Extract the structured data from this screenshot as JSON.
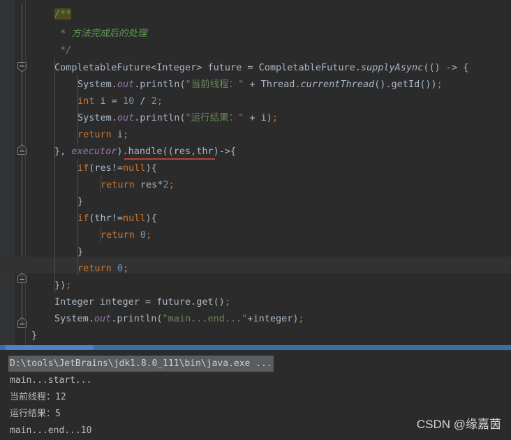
{
  "editor": {
    "theme": {
      "background": "#2b2b2b",
      "gutter_background": "#313335",
      "current_line": "#323232",
      "default_text": "#a9b7c6",
      "keyword": "#cc7832",
      "string": "#6a8759",
      "number": "#6897bb",
      "comment": "#629755",
      "static_field": "#9876aa",
      "error_underline": "#bc3f3c",
      "scrollbar": "#3c6ea5"
    },
    "code_lines": [
      {
        "indent": 4,
        "text": "/**",
        "kind": "comment-start-highlighted"
      },
      {
        "indent": 4,
        "text": " * 方法完成后的处理",
        "kind": "comment"
      },
      {
        "indent": 4,
        "text": " */",
        "kind": "comment"
      },
      {
        "indent": 4,
        "text": "CompletableFuture<Integer> future = CompletableFuture.supplyAsync(() -> {",
        "kind": "code"
      },
      {
        "indent": 8,
        "text": "System.out.println(\"当前线程：\" + Thread.currentThread().getId());",
        "kind": "code"
      },
      {
        "indent": 8,
        "text": "int i = 10 / 2;",
        "kind": "code"
      },
      {
        "indent": 8,
        "text": "System.out.println(\"运行结果：\" + i);",
        "kind": "code"
      },
      {
        "indent": 8,
        "text": "return i;",
        "kind": "code"
      },
      {
        "indent": 4,
        "text": "}, executor).handle((res,thr)->{",
        "kind": "code-error"
      },
      {
        "indent": 6,
        "text": "if(res!=null){",
        "kind": "code"
      },
      {
        "indent": 10,
        "text": "return res*2;",
        "kind": "code"
      },
      {
        "indent": 6,
        "text": "}",
        "kind": "code"
      },
      {
        "indent": 6,
        "text": "if(thr!=null){",
        "kind": "code"
      },
      {
        "indent": 10,
        "text": "return 0;",
        "kind": "code"
      },
      {
        "indent": 6,
        "text": "}",
        "kind": "code"
      },
      {
        "indent": 6,
        "text": "return 0;",
        "kind": "code-current"
      },
      {
        "indent": 4,
        "text": "});",
        "kind": "code"
      },
      {
        "indent": 4,
        "text": "Integer integer = future.get();",
        "kind": "code"
      },
      {
        "indent": 4,
        "text": "System.out.println(\"main...end...\"+integer);",
        "kind": "code"
      },
      {
        "indent": 2,
        "text": "}",
        "kind": "code"
      }
    ],
    "fold_markers": [
      "collapse-marker-method",
      "collapse-marker-lambda-end",
      "collapse-marker-block-end",
      "collapse-marker-class-end"
    ]
  },
  "console": {
    "command_line": "D:\\tools\\JetBrains\\jdk1.8.0_111\\bin\\java.exe ...",
    "output_lines": [
      "main...start...",
      "当前线程：12",
      "运行结果：5",
      "main...end...10"
    ]
  },
  "watermark": {
    "text": "CSDN @缘嘉茵"
  },
  "tokens": {
    "l0_comment": "/**",
    "l1_comment": " * 方法完成后的处理",
    "l2_comment": " */",
    "l3_a": "CompletableFuture<Integer> future = CompletableFuture.",
    "l3_b": "supplyAsync",
    "l3_c": "(() -> {",
    "l4_a": "System.",
    "l4_b": "out",
    "l4_c": ".println(",
    "l4_str": "\"当前线程：\"",
    "l4_d": " + Thread.",
    "l4_e": "currentThread",
    "l4_f": "().getId())",
    "l4_semi": ";",
    "l5_kw": "int",
    "l5_a": " i = ",
    "l5_n1": "10",
    "l5_b": " / ",
    "l5_n2": "2",
    "l5_semi": ";",
    "l6_a": "System.",
    "l6_b": "out",
    "l6_c": ".println(",
    "l6_str": "\"运行结果：\"",
    "l6_d": " + i)",
    "l6_semi": ";",
    "l7_kw": "return",
    "l7_a": " i",
    "l7_semi": ";",
    "l8_a": "}, ",
    "l8_b": "executor",
    "l8_c": ").handle((res,thr)->{",
    "l9_kw": "if",
    "l9_a": "(res!=",
    "l9_null": "null",
    "l9_b": "){",
    "l10_kw": "return",
    "l10_a": " res*",
    "l10_n": "2",
    "l10_semi": ";",
    "l11_a": "}",
    "l12_kw": "if",
    "l12_a": "(thr!=",
    "l12_null": "null",
    "l12_b": "){",
    "l13_kw": "return",
    "l13_a": " ",
    "l13_n": "0",
    "l13_semi": ";",
    "l14_a": "}",
    "l15_kw": "return",
    "l15_a": " ",
    "l15_n": "0",
    "l15_semi": ";",
    "l16_a": "})",
    "l16_semi": ";",
    "l17_a": "Integer integer = future.get()",
    "l17_semi": ";",
    "l18_a": "System.",
    "l18_b": "out",
    "l18_c": ".println(",
    "l18_str": "\"main...end...\"",
    "l18_d": "+integer)",
    "l18_semi": ";",
    "l19_a": "}"
  }
}
